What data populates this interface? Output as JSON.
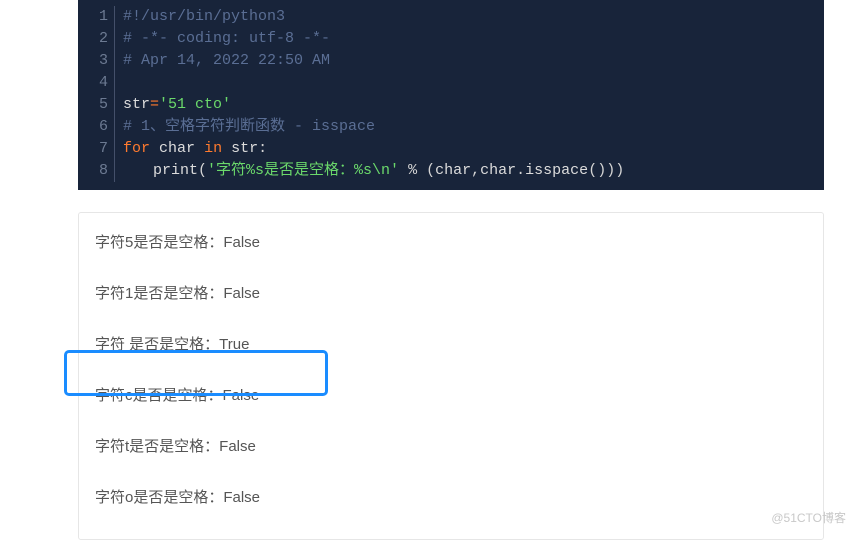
{
  "code": {
    "lines": [
      {
        "n": "1",
        "html": "<span class='cm'>#!/usr/bin/python3</span>"
      },
      {
        "n": "2",
        "html": "<span class='cm'># -*- coding: utf-8 -*-</span>"
      },
      {
        "n": "3",
        "html": "<span class='cm'># Apr 14, 2022 22:50 AM</span>"
      },
      {
        "n": "4",
        "html": ""
      },
      {
        "n": "5",
        "html": "<span class='id'>str</span><span class='eq'>=</span><span class='str'>'51 cto'</span>"
      },
      {
        "n": "6",
        "html": "<span class='cm'># 1、空格字符判断函数 - isspace</span>"
      },
      {
        "n": "7",
        "html": "<span class='eq'>for</span> <span class='id'>char</span> <span class='eq'>in</span> <span class='id'>str</span><span class='op'>:</span>"
      },
      {
        "n": "8",
        "html": "<span class='ind'></span><span class='id'>print</span><span class='op'>(</span><span class='str'>'字符%s是否是空格：%s\\n'</span> <span class='op'>%</span> <span class='op'>(</span><span class='id'>char</span><span class='op'>,</span><span class='id'>char</span><span class='op'>.</span><span class='id'>isspace</span><span class='op'>()))</span>"
      }
    ]
  },
  "output": {
    "lines": [
      "字符5是否是空格：False",
      "字符1是否是空格：False",
      "字符 是否是空格：True",
      "字符c是否是空格：False",
      "字符t是否是空格：False",
      "字符o是否是空格：False"
    ]
  },
  "watermark": "@51CTO博客"
}
